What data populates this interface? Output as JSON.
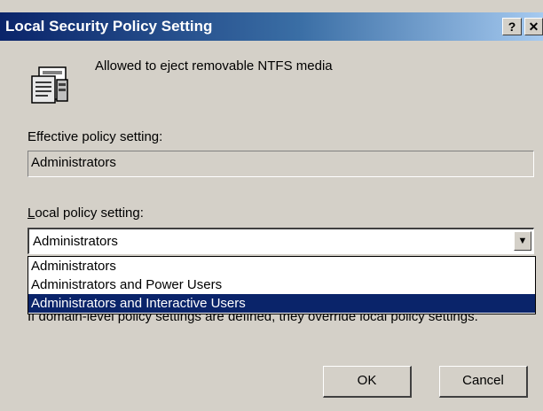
{
  "window": {
    "title": "Local Security Policy Setting",
    "help_label": "?",
    "close_label": "✕"
  },
  "policy": {
    "name": "Allowed to eject removable NTFS media",
    "icon": "policy-document-icon"
  },
  "effective": {
    "label": "Effective policy setting:",
    "value": "Administrators"
  },
  "local": {
    "label_accesskey": "L",
    "label_rest": "ocal policy setting:",
    "selected": "Administrators",
    "options": [
      "Administrators",
      "Administrators and Power Users",
      "Administrators and Interactive Users"
    ],
    "highlighted_index": 2
  },
  "info": {
    "text": "If domain-level policy settings are defined, they override local policy settings."
  },
  "buttons": {
    "ok": "OK",
    "cancel": "Cancel"
  },
  "colors": {
    "dialog_bg": "#d4d0c8",
    "titlebar_start": "#0a246a",
    "titlebar_end": "#a6caf0",
    "selection": "#0a246a"
  }
}
